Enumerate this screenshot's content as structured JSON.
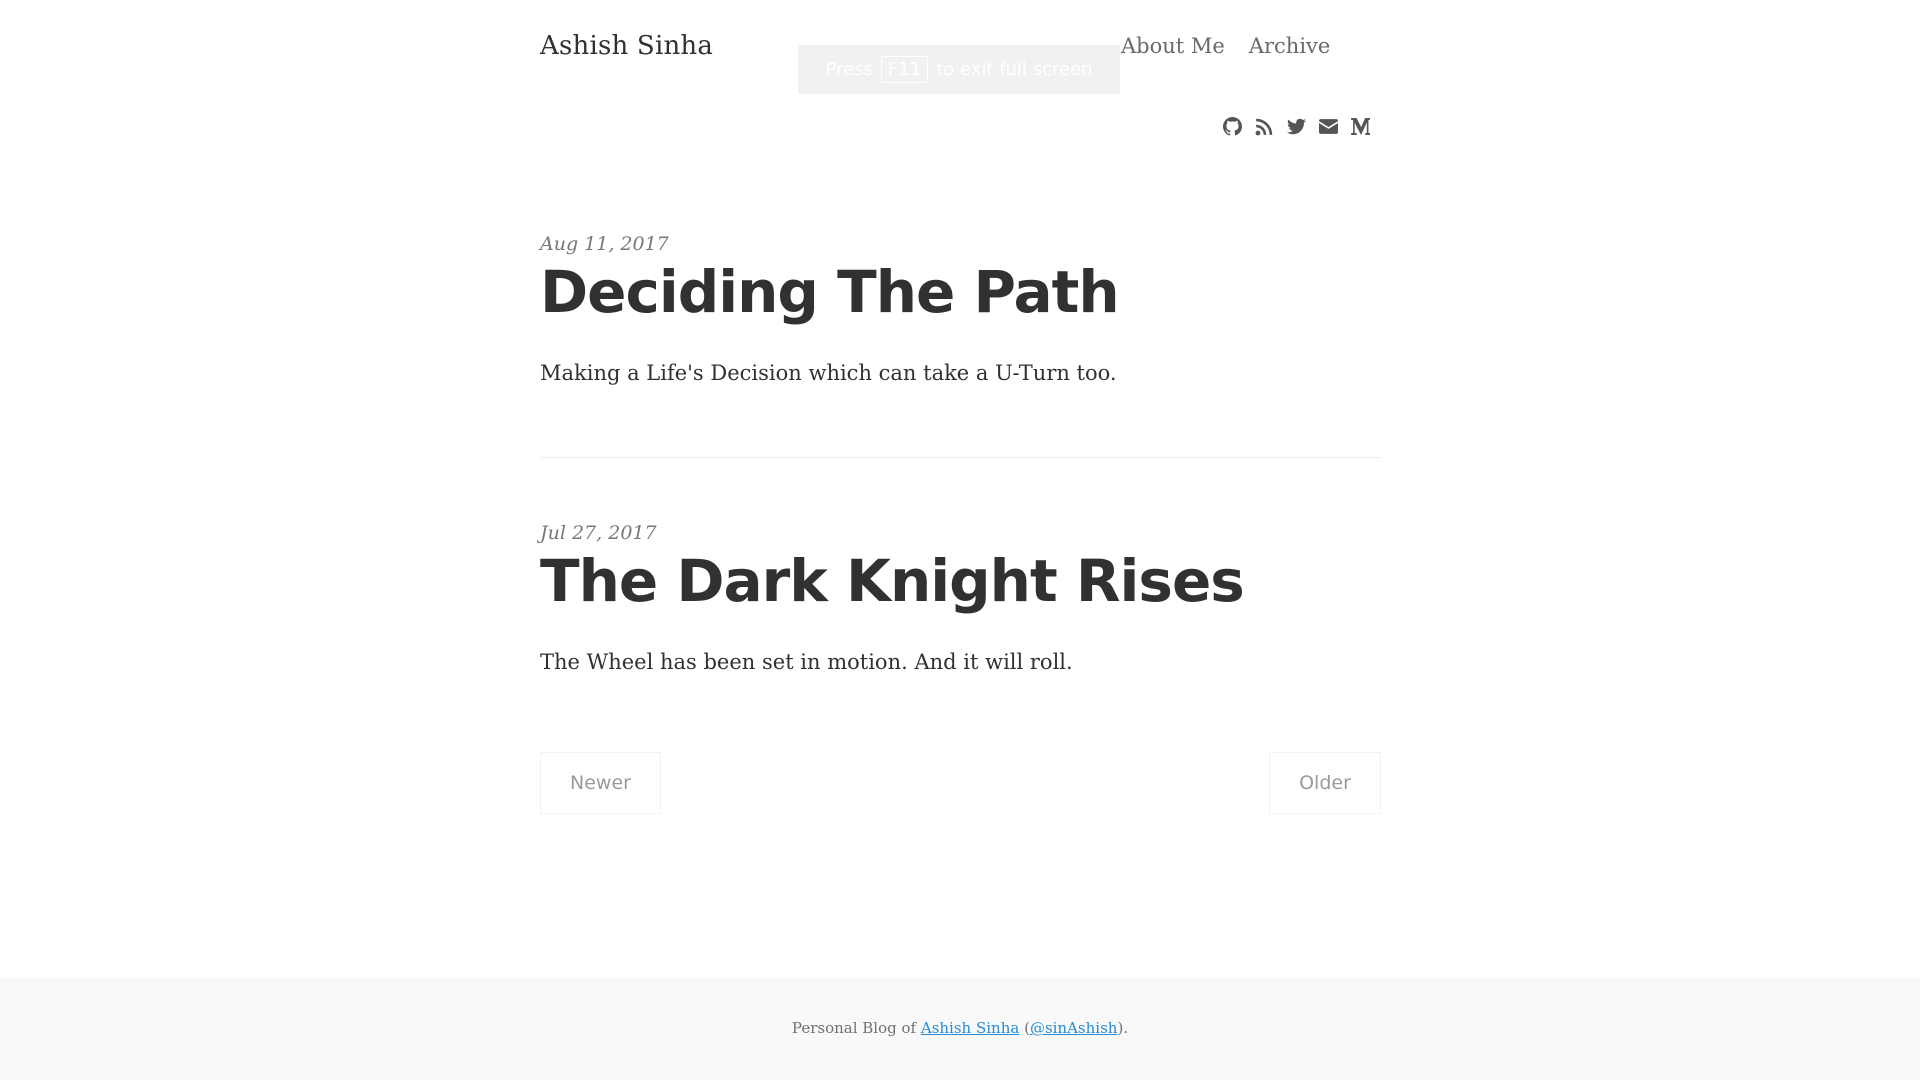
{
  "header": {
    "site_title": "Ashish Sinha",
    "nav": {
      "about": "About Me",
      "archive": "Archive"
    },
    "fullscreen_toast": {
      "prefix": "Press",
      "key": "F11",
      "suffix": "to exit full screen"
    },
    "social_icons": [
      "github-icon",
      "rss-icon",
      "twitter-icon",
      "envelope-icon",
      "medium-icon"
    ]
  },
  "posts": [
    {
      "date": "Aug 11, 2017",
      "title": "Deciding The Path",
      "excerpt": "Making a Life's Decision which can take a U-Turn too."
    },
    {
      "date": "Jul 27, 2017",
      "title": "The Dark Knight Rises",
      "excerpt": "The Wheel has been set in motion. And it will roll."
    }
  ],
  "pagination": {
    "newer": "Newer",
    "older": "Older"
  },
  "footer": {
    "prefix": "Personal Blog of ",
    "author_link": "Ashish Sinha",
    "open_paren": " (",
    "handle_link": "@sinAshish",
    "close": ")."
  },
  "colors": {
    "text": "#313131",
    "muted": "#777777",
    "link": "#268bd2",
    "footer_bg": "#f9f9f9"
  }
}
